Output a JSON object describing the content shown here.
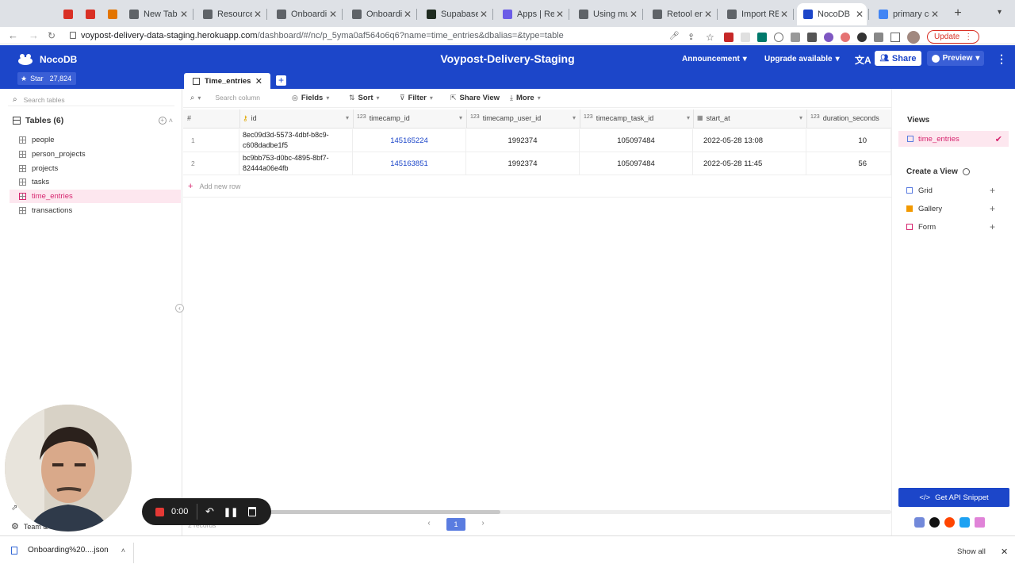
{
  "browser": {
    "tabs": [
      {
        "title": "",
        "icon": "gmail-icon",
        "color": "#d93025"
      },
      {
        "title": "",
        "icon": "gmail-icon",
        "color": "#d93025"
      },
      {
        "title": "",
        "icon": "drive-icon",
        "color": "#e37400"
      },
      {
        "title": "New Tab",
        "icon": "chrome-icon",
        "color": "#5f6368"
      },
      {
        "title": "Resources",
        "icon": "stack-icon",
        "color": "#5f6368"
      },
      {
        "title": "Onboarding",
        "icon": "stack-icon",
        "color": "#5f6368"
      },
      {
        "title": "Onboarding",
        "icon": "stack-icon",
        "color": "#5f6368"
      },
      {
        "title": "Supabase",
        "icon": "supabase-icon",
        "color": "#1f2b20"
      },
      {
        "title": "Apps | Retool",
        "icon": "retool-icon",
        "color": "#6b5ce7"
      },
      {
        "title": "Using multi",
        "icon": "stack-icon",
        "color": "#5f6368"
      },
      {
        "title": "Retool envir",
        "icon": "stack-icon",
        "color": "#5f6368"
      },
      {
        "title": "Import RES",
        "icon": "stack-icon",
        "color": "#5f6368"
      },
      {
        "title": "NocoDB",
        "icon": "nocodb-icon",
        "color": "#1c46c9"
      },
      {
        "title": "primary col",
        "icon": "google-icon",
        "color": "#4285f4"
      }
    ],
    "url_host": "voypost-delivery-data-staging.herokuapp.com",
    "url_path": "/dashboard/#/nc/p_5yma0af564o6q6?name=time_entries&dbalias=&type=table",
    "update_label": "Update"
  },
  "app": {
    "brand": "NocoDB",
    "star_label": "Star",
    "star_count": "27,824",
    "project_title": "Voypost-Delivery-Staging",
    "announcement": "Announcement",
    "upgrade": "Upgrade available",
    "share": "Share",
    "preview": "Preview",
    "open_tab": "Time_entries"
  },
  "sidebar": {
    "search_placeholder": "Search tables",
    "tables_header": "Tables (6)",
    "tables": [
      "people",
      "person_projects",
      "projects",
      "tasks",
      "time_entries",
      "transactions"
    ],
    "selected": "time_entries",
    "team_label": "Team &"
  },
  "toolbar": {
    "search_placeholder": "Search column",
    "fields": "Fields",
    "sort": "Sort",
    "filter": "Filter",
    "share_view": "Share View",
    "more": "More"
  },
  "grid": {
    "columns": [
      "#",
      "id",
      "timecamp_id",
      "timecamp_user_id",
      "timecamp_task_id",
      "start_at",
      "duration_seconds"
    ],
    "rows": [
      {
        "n": "1",
        "id_a": "8ec09d3d-5573-4dbf-b8c9-",
        "id_b": "c608dadbe1f5",
        "timecamp_id": "145165224",
        "user_id": "1992374",
        "task_id": "105097484",
        "start_at": "2022-05-28 13:08",
        "duration": "10"
      },
      {
        "n": "2",
        "id_a": "bc9bb753-d0bc-4895-8bf7-",
        "id_b": "82444a06e4fb",
        "timecamp_id": "145163851",
        "user_id": "1992374",
        "task_id": "105097484",
        "start_at": "2022-05-28 11:45",
        "duration": "56"
      }
    ],
    "add_row": "Add new row",
    "records": "2 records",
    "page": "1"
  },
  "views": {
    "header": "Views",
    "current": "time_entries",
    "create_header": "Create a View",
    "types": [
      "Grid",
      "Gallery",
      "Form"
    ],
    "api_snippet": "Get API Snippet"
  },
  "recorder": {
    "time": "0:00"
  },
  "downloads": {
    "file": "Onboarding%20....json",
    "show_all": "Show all"
  },
  "colors": {
    "brand_blue": "#1c46c9",
    "pink": "#d6246e"
  }
}
